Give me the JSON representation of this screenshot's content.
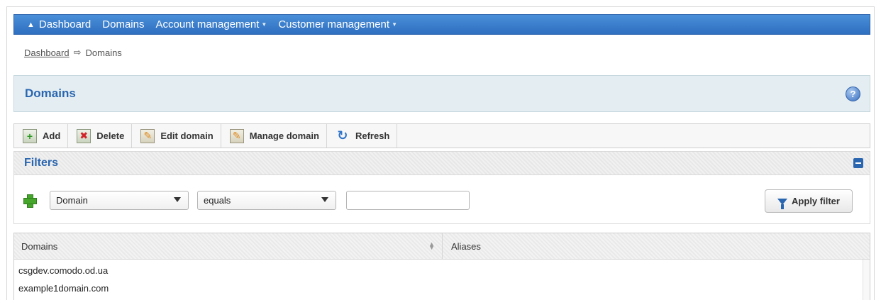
{
  "nav": {
    "items": [
      {
        "label": "Dashboard",
        "icon": "home-icon"
      },
      {
        "label": "Domains"
      },
      {
        "label": "Account management",
        "has_dropdown": true
      },
      {
        "label": "Customer management",
        "has_dropdown": true
      }
    ],
    "colors": {
      "bar": "#3b7ccc",
      "text": "#ffffff"
    }
  },
  "breadcrumb": {
    "items": [
      "Dashboard",
      "Domains"
    ],
    "separator_icon": "arrow-right-icon"
  },
  "panel": {
    "title": "Domains",
    "help_glyph": "?"
  },
  "toolbar": {
    "add_label": "Add",
    "delete_label": "Delete",
    "edit_label": "Edit domain",
    "manage_label": "Manage domain",
    "refresh_label": "Refresh"
  },
  "filters": {
    "title": "Filters",
    "field_select": "Domain",
    "operator_select": "equals",
    "value_input": "",
    "apply_label": "Apply filter"
  },
  "table": {
    "columns": [
      "Domains",
      "Aliases"
    ],
    "rows": [
      {
        "domain": "csgdev.comodo.od.ua",
        "aliases": ""
      },
      {
        "domain": "example1domain.com",
        "aliases": ""
      }
    ]
  },
  "colors": {
    "accent": "#2a66b0",
    "header_bg": "#e4eef2"
  }
}
